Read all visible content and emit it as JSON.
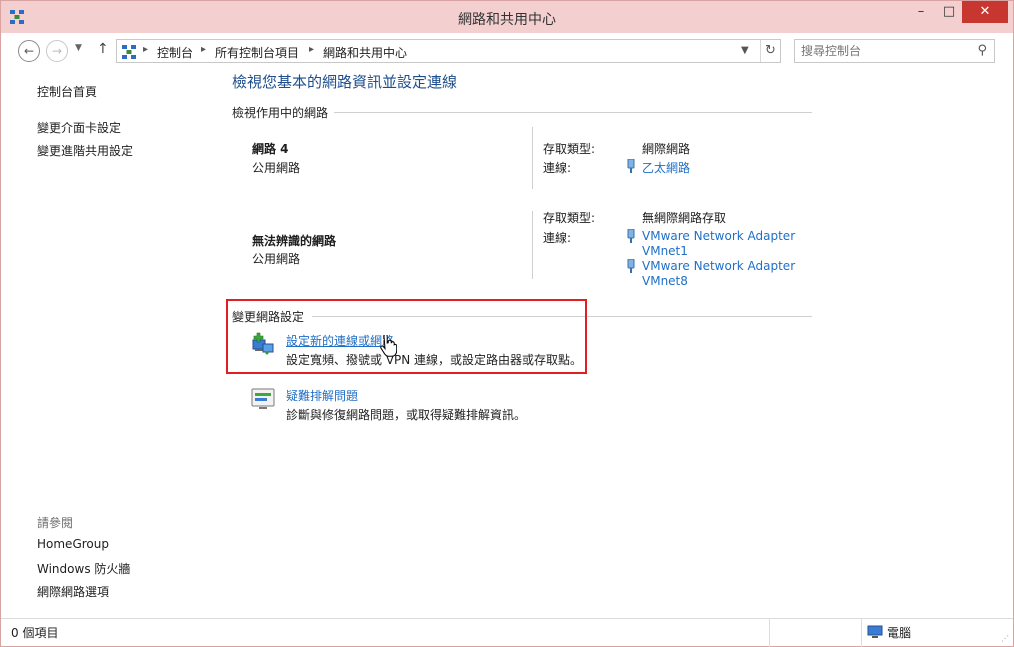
{
  "window": {
    "title": "網路和共用中心"
  },
  "address": {
    "crumbs": [
      "控制台",
      "所有控制台項目",
      "網路和共用中心"
    ],
    "separator": "▸"
  },
  "search": {
    "placeholder": "搜尋控制台"
  },
  "sidebar": {
    "home": "控制台首頁",
    "links": [
      "變更介面卡設定",
      "變更進階共用設定"
    ],
    "see_also_label": "請參閱",
    "see_also": [
      "HomeGroup",
      "Windows 防火牆",
      "網際網路選項"
    ]
  },
  "main": {
    "title": "檢視您基本的網路資訊並設定連線",
    "active_networks_heading": "檢視作用中的網路",
    "networks": [
      {
        "name": "網路  4",
        "type": "公用網路",
        "access_label": "存取類型:",
        "access_value": "網際網路",
        "conn_label": "連線:",
        "connections": [
          "乙太網路"
        ]
      },
      {
        "name": "無法辨識的網路",
        "type": "公用網路",
        "access_label": "存取類型:",
        "access_value": "無網際網路存取",
        "conn_label": "連線:",
        "connections": [
          "VMware Network Adapter\nVMnet1",
          "VMware Network Adapter\nVMnet8"
        ]
      }
    ],
    "change_heading": "變更網路設定",
    "tasks": [
      {
        "link": "設定新的連線或網路",
        "desc": "設定寬頻、撥號或 VPN 連線，或設定路由器或存取點。"
      },
      {
        "link": "疑難排解問題",
        "desc": "診斷與修復網路問題，或取得疑難排解資訊。"
      }
    ]
  },
  "status": {
    "items": "0 個項目",
    "location": "電腦"
  },
  "colors": {
    "titlebar": "#f4cfcf",
    "close": "#c7372f",
    "link": "#1f6fc6",
    "heading": "#1e4e8c",
    "highlight": "#e02020"
  },
  "icons": [
    "network-center-icon",
    "back-arrow-icon",
    "forward-arrow-icon",
    "up-arrow-icon",
    "refresh-icon",
    "search-icon",
    "ethernet-plug-icon",
    "new-connection-icon",
    "troubleshoot-icon",
    "hand-cursor-icon",
    "computer-icon"
  ]
}
